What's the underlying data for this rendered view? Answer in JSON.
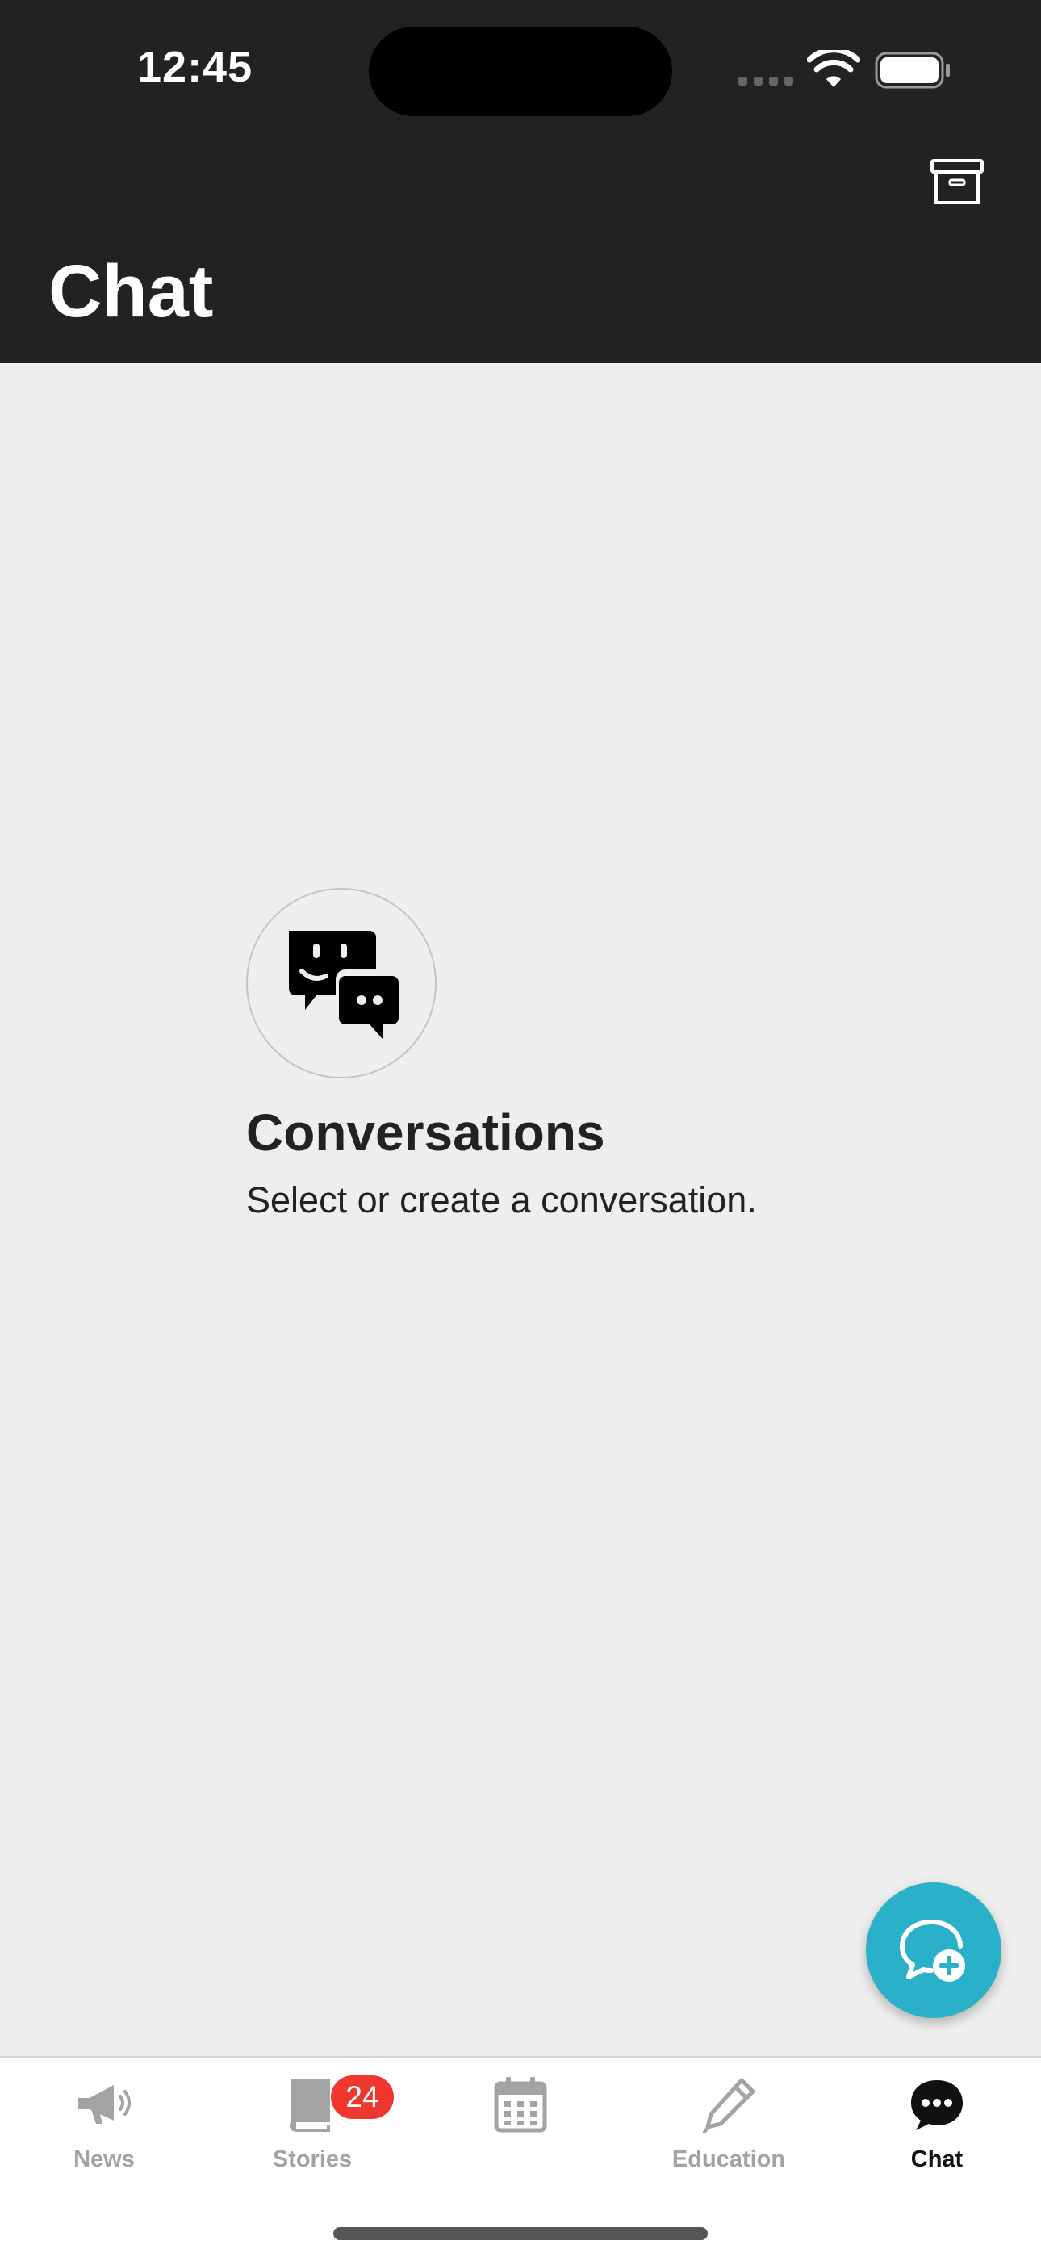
{
  "status_bar": {
    "time": "12:45"
  },
  "header": {
    "title": "Chat",
    "archive_icon": "archive-box-icon"
  },
  "empty_state": {
    "icon": "chat-bubbles-icon",
    "title": "Conversations",
    "subtitle": "Select or create a conversation."
  },
  "fab": {
    "icon": "new-chat-plus-icon",
    "color": "#2ab0c9"
  },
  "tabs": [
    {
      "label": "News",
      "icon": "megaphone-icon",
      "active": false
    },
    {
      "label": "Stories",
      "icon": "book-icon",
      "badge": "24",
      "active": false
    },
    {
      "label": "",
      "icon": "calendar-icon",
      "active": false
    },
    {
      "label": "Education",
      "icon": "pencil-icon",
      "active": false
    },
    {
      "label": "Chat",
      "icon": "chat-bubble-icon",
      "active": true
    }
  ],
  "colors": {
    "header_bg": "#222222",
    "content_bg": "#eeeeee",
    "badge": "#f0372f",
    "tab_inactive": "#a3a3a3",
    "tab_active": "#111111"
  }
}
